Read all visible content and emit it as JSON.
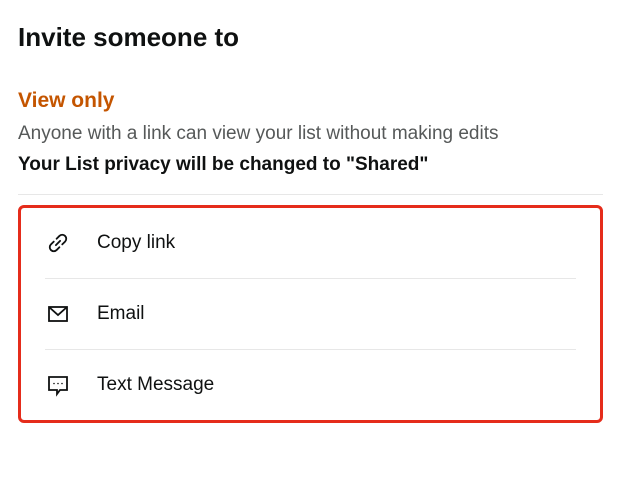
{
  "header": {
    "title": "Invite someone to"
  },
  "permission": {
    "label": "View only",
    "description": "Anyone with a link can view your list without making edits",
    "privacy_note": "Your List privacy will be changed to \"Shared\""
  },
  "share_options": [
    {
      "label": "Copy link",
      "icon": "link-icon"
    },
    {
      "label": "Email",
      "icon": "email-icon"
    },
    {
      "label": "Text Message",
      "icon": "text-message-icon"
    }
  ]
}
